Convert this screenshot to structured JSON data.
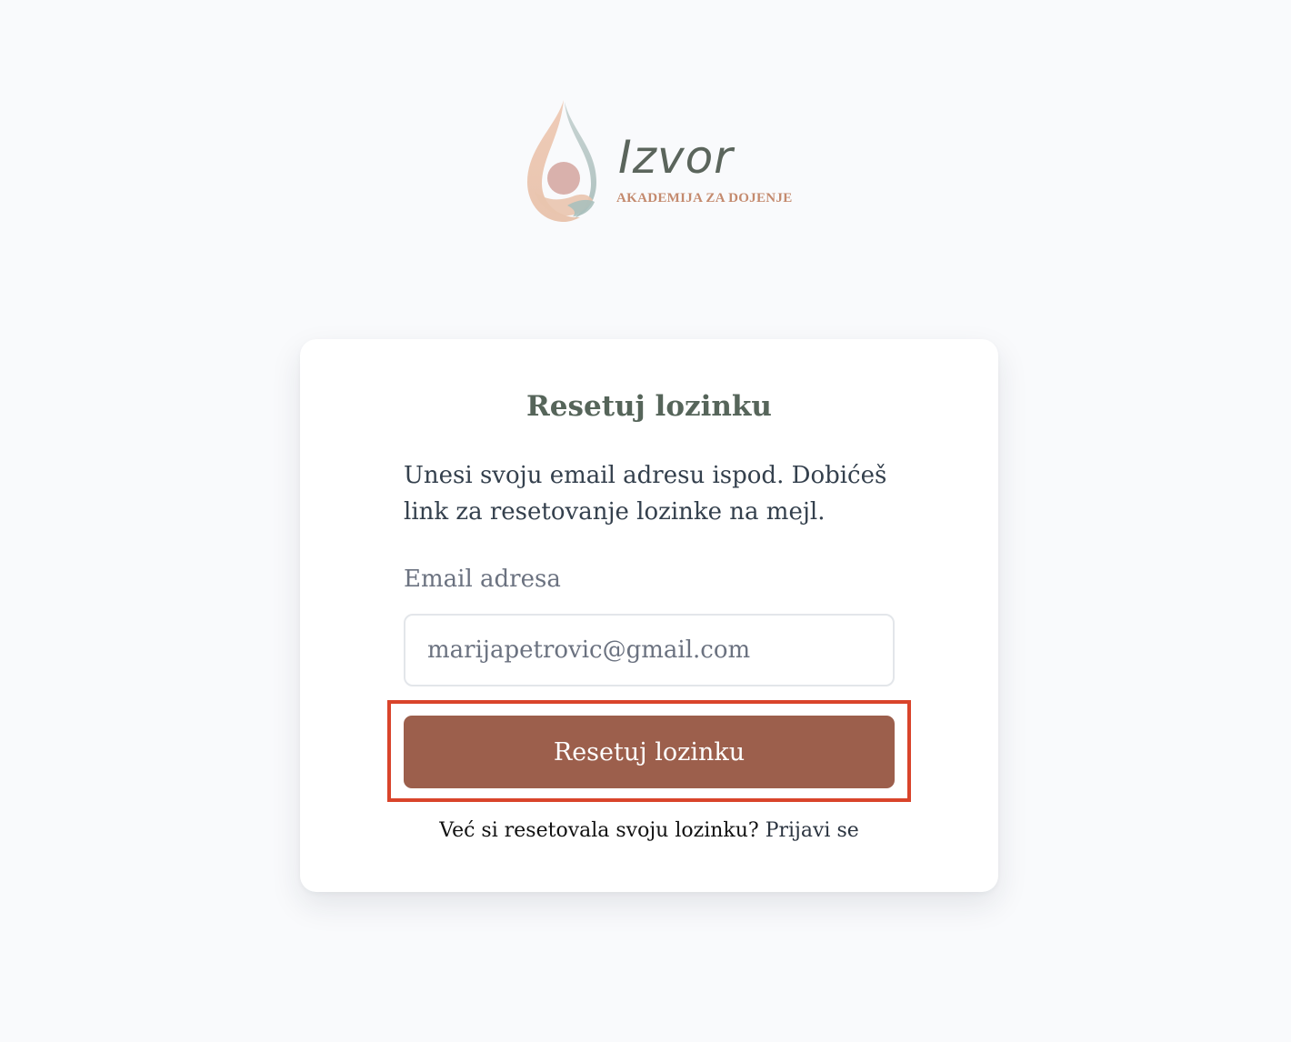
{
  "logo": {
    "wordmark": "Izvor",
    "tagline": "AKADEMIJA ZA DOJENJE"
  },
  "reset_form": {
    "title": "Resetuj lozinku",
    "description": "Unesi svoju email adresu ispod. Dobićeš link za resetovanje lozinke na mejl.",
    "email_label": "Email adresa",
    "email_value": "marijapetrovic@gmail.com",
    "submit_label": "Resetuj lozinku",
    "footer_prompt": "Već si resetovala svoju lozinku?",
    "login_link": "Prijavi se"
  },
  "colors": {
    "background": "#f9fafc",
    "title": "#56655a",
    "button": "#9c5f4c",
    "highlight": "#d9442b"
  }
}
